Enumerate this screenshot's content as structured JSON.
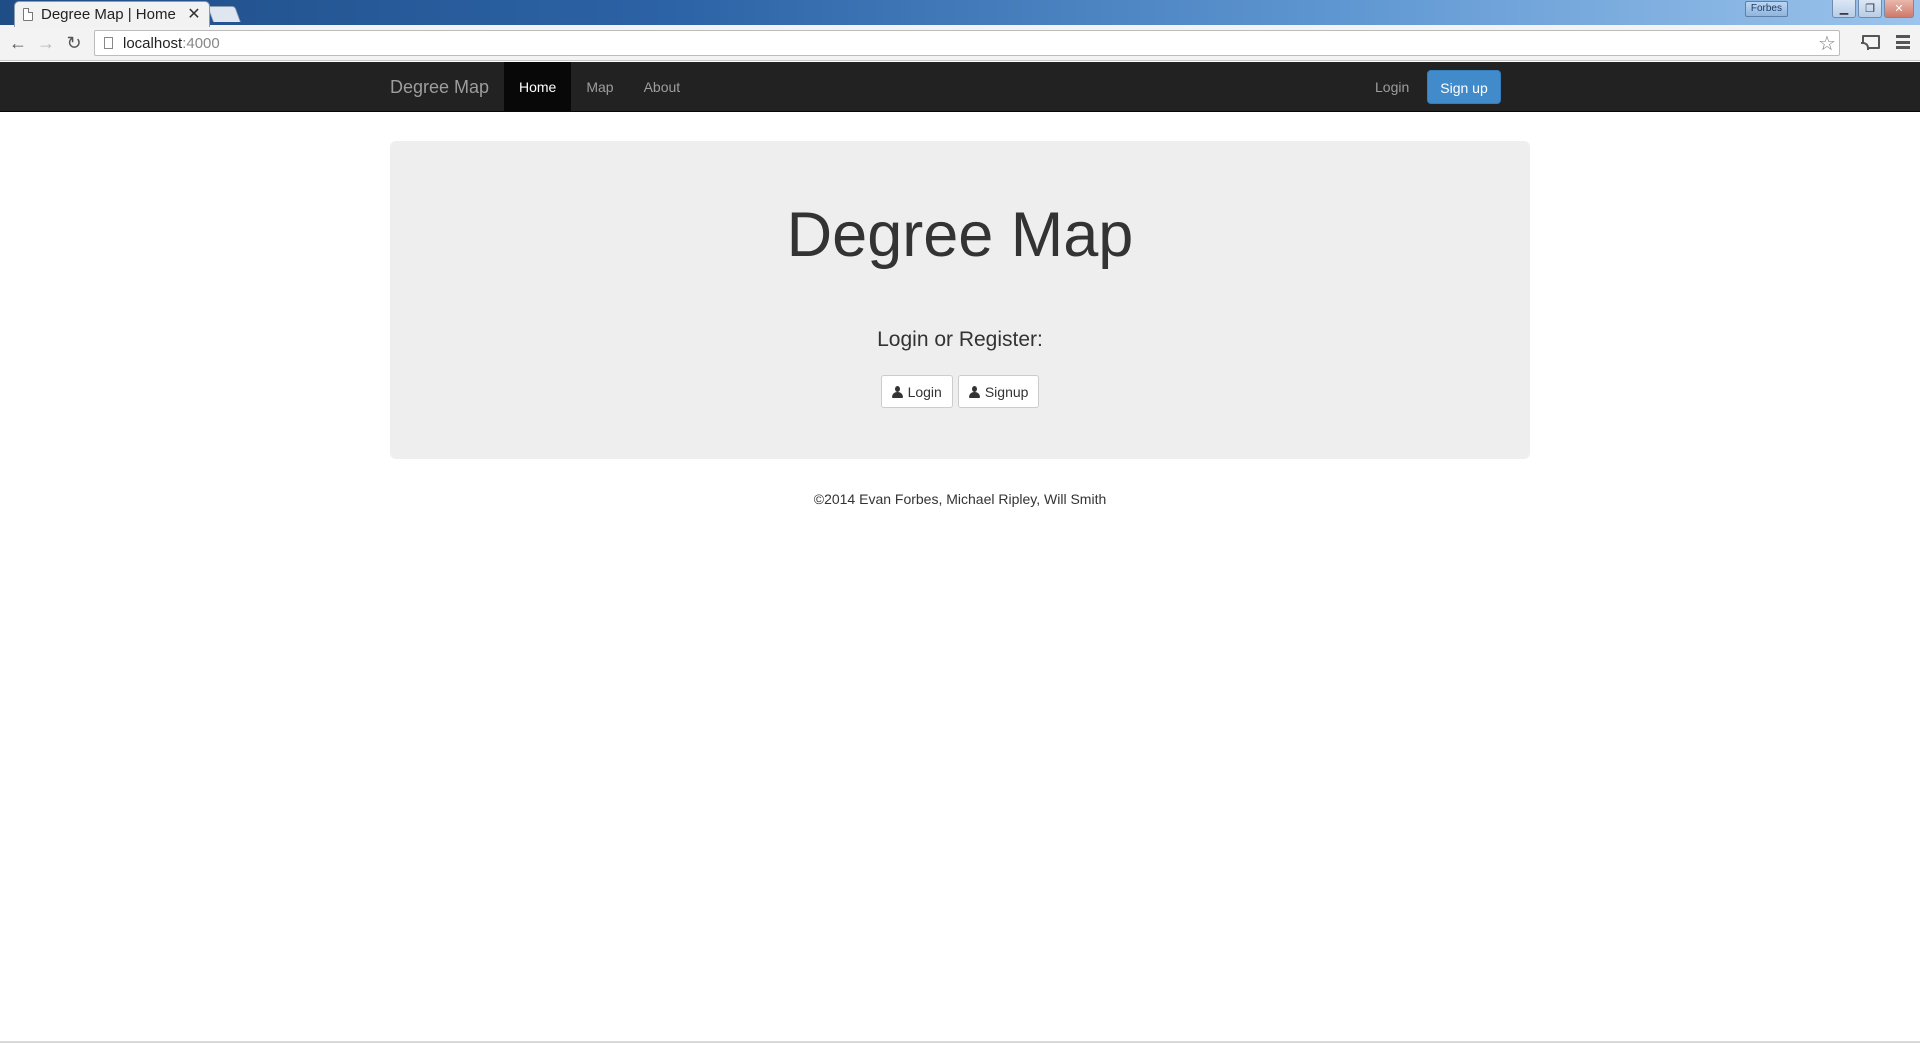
{
  "browser": {
    "tab_title": "Degree Map | Home",
    "tab_close": "✕",
    "profile_name": "Forbes",
    "url_host": "localhost",
    "url_port": ":4000"
  },
  "navbar": {
    "brand": "Degree Map",
    "links": [
      "Home",
      "Map",
      "About"
    ],
    "active_link": "Home",
    "login": "Login",
    "signup": "Sign up",
    "colors": {
      "background": "#222222",
      "active_bg": "#080808",
      "primary": "#428bca"
    }
  },
  "jumbotron": {
    "title": "Degree Map",
    "subtitle": "Login or Register:",
    "login_button": "Login",
    "signup_button": "Signup"
  },
  "footer": {
    "text": "©2014 Evan Forbes, Michael Ripley, Will Smith"
  }
}
